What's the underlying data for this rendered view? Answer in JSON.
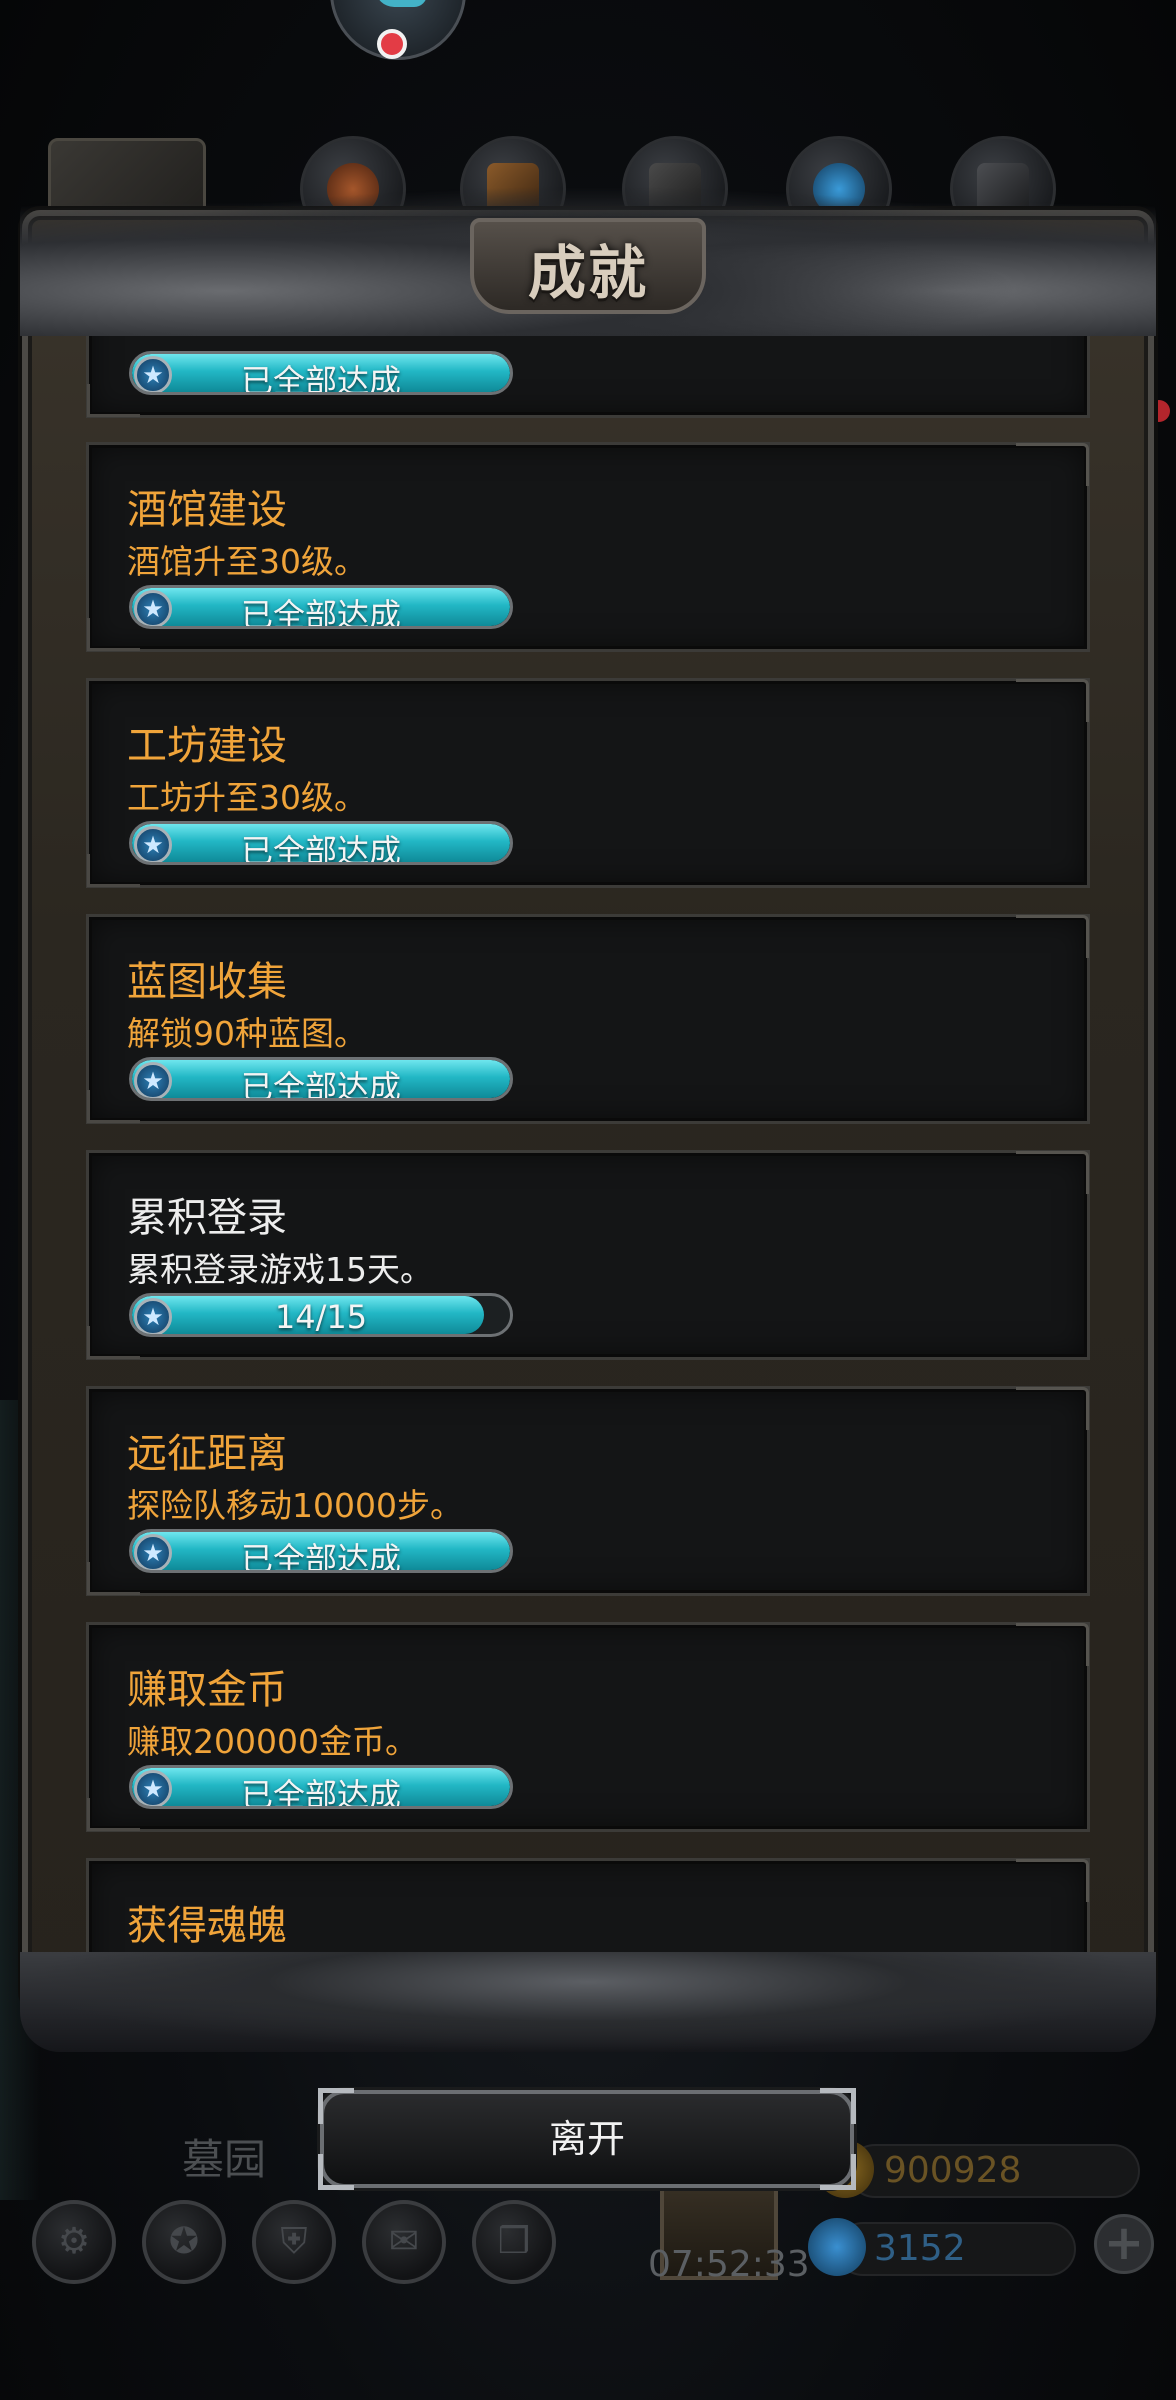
{
  "window": {
    "title": "成就"
  },
  "achievements": [
    {
      "title": "",
      "desc": "",
      "progress_text": "已全部达成",
      "progress": 1.0,
      "completed": true
    },
    {
      "title": "酒馆建设",
      "desc": "酒馆升至30级。",
      "progress_text": "已全部达成",
      "progress": 1.0,
      "completed": true
    },
    {
      "title": "工坊建设",
      "desc": "工坊升至30级。",
      "progress_text": "已全部达成",
      "progress": 1.0,
      "completed": true
    },
    {
      "title": "蓝图收集",
      "desc": "解锁90种蓝图。",
      "progress_text": "已全部达成",
      "progress": 1.0,
      "completed": true
    },
    {
      "title": "累积登录",
      "desc": "累积登录游戏15天。",
      "progress_text": "14/15",
      "progress": 0.93,
      "completed": false
    },
    {
      "title": "远征距离",
      "desc": "探险队移动10000步。",
      "progress_text": "已全部达成",
      "progress": 1.0,
      "completed": true
    },
    {
      "title": "赚取金币",
      "desc": "赚取200000金币。",
      "progress_text": "已全部达成",
      "progress": 1.0,
      "completed": true
    },
    {
      "title": "获得魂魄",
      "desc": "",
      "progress_text": "",
      "progress": 0,
      "completed": true
    }
  ],
  "colors": {
    "completed_text": "#f0a43a",
    "incomplete_text": "#ededed",
    "bar_fill": "#22b7c5"
  },
  "footer": {
    "leave_label": "离开",
    "location_label": "墓园",
    "time": "07:52:33",
    "gold": "900928",
    "gems": "3152",
    "plus_label": "+"
  },
  "icons": {
    "bar_star": "★",
    "hud": [
      "gear-icon",
      "star-badge-icon",
      "shield-icon",
      "mail-icon",
      "cube-icon"
    ]
  }
}
